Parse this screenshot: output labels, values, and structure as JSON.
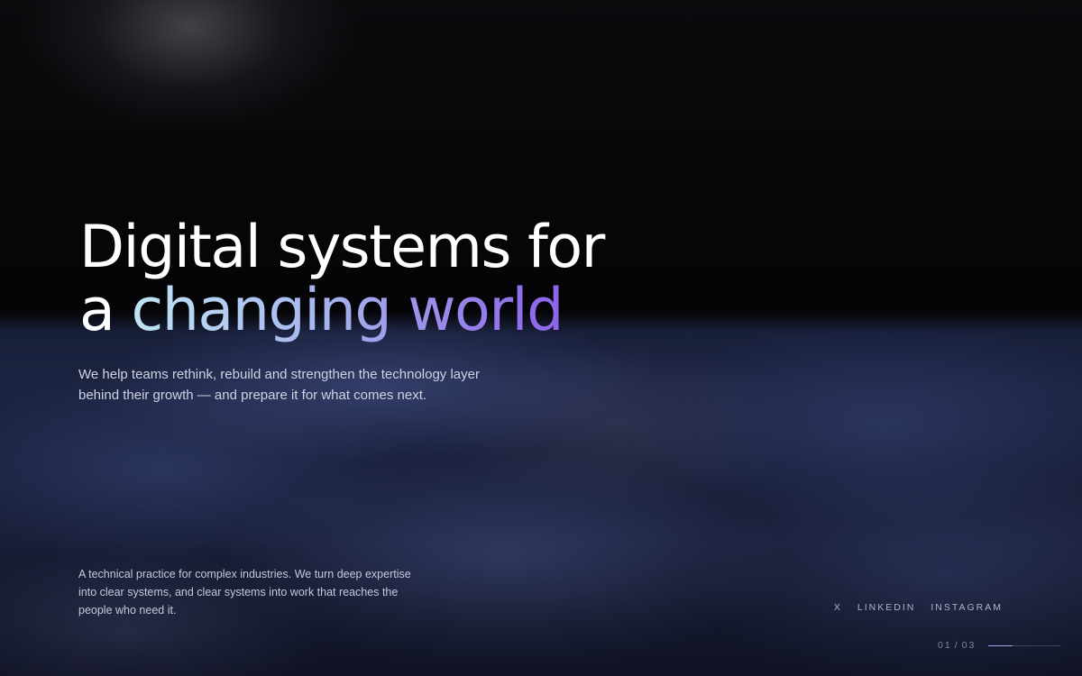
{
  "hero": {
    "title_line1": "Digital systems for",
    "title_line2_plain": "a ",
    "title_line2_highlight": "changing world",
    "subtitle": "We help teams rethink, rebuild and strengthen the technology layer behind their growth — and prepare it for what comes next."
  },
  "about": {
    "text": "A technical practice for complex industries. We turn deep expertise into clear systems, and clear systems into work that reaches the people who need it."
  },
  "social": {
    "items": [
      {
        "label": "X"
      },
      {
        "label": "LINKEDIN"
      },
      {
        "label": "INSTAGRAM"
      }
    ]
  },
  "pager": {
    "current": "01",
    "separator": "/",
    "total": "03",
    "progress": 0.333
  },
  "colors": {
    "background": "#050507",
    "cloud_blue": "#1e2646",
    "gradient_start": "#bfe4f4",
    "gradient_mid": "#9b8fe9",
    "gradient_end": "#8a5cec",
    "text_primary": "#ffffff",
    "text_secondary": "#cfd3e3"
  }
}
